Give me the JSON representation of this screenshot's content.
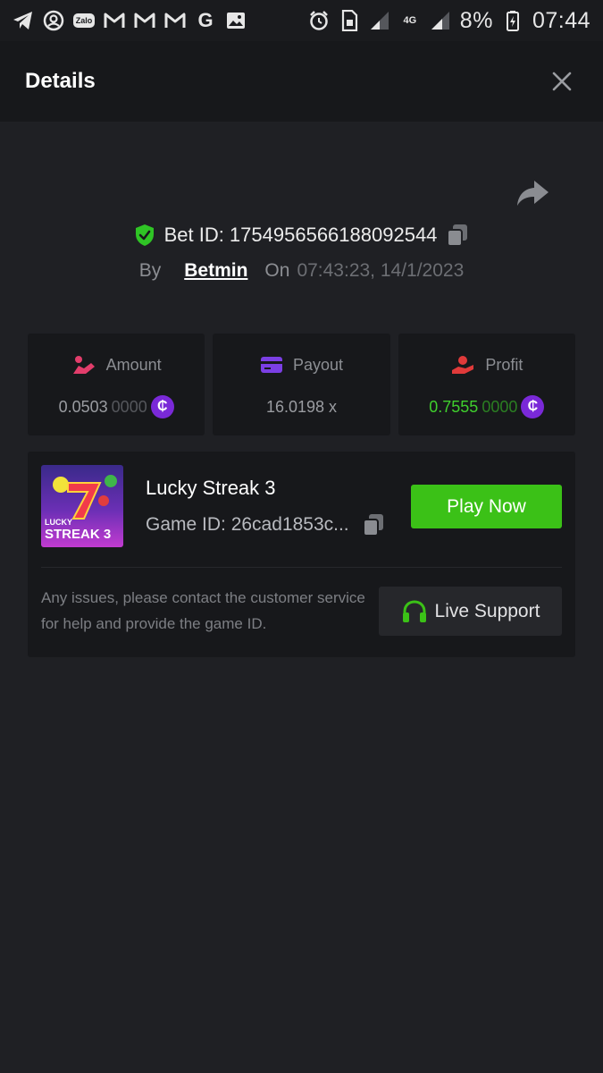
{
  "status_bar": {
    "left_icons": [
      "telegram-icon",
      "account-icon",
      "zalo-icon",
      "gmail-icon",
      "gmail-icon",
      "gmail-icon",
      "google-icon",
      "gallery-icon"
    ],
    "zalo_label": "Zalo",
    "google_letter": "G",
    "network_label": "4G",
    "battery_percent": "8%",
    "time": "07:44"
  },
  "header": {
    "title": "Details"
  },
  "bet": {
    "id_label": "Bet ID: 1754956566188092544",
    "by_label": "By",
    "user": "Betmin",
    "on_label": "On",
    "datetime": "07:43:23, 14/1/2023"
  },
  "stats": {
    "amount": {
      "label": "Amount",
      "value_main": "0.0503",
      "value_dim": "0000",
      "currency_symbol": "₵"
    },
    "payout": {
      "label": "Payout",
      "value": "16.0198 x"
    },
    "profit": {
      "label": "Profit",
      "value_main": "0.7555",
      "value_dim": "0000",
      "currency_symbol": "₵"
    }
  },
  "game": {
    "thumb_line1": "LUCKY",
    "thumb_line2": "STREAK 3",
    "name": "Lucky Streak 3",
    "id_label": "Game ID: 26cad1853c...",
    "play_label": "Play Now",
    "support_text": "Any issues, please contact the customer service for help and provide the game ID.",
    "support_label": "Live Support"
  },
  "colors": {
    "background": "#1f2024",
    "card": "#17181b",
    "accent_green": "#3bc117",
    "profit_green": "#3fcf2d",
    "coin_purple": "#7a29d8",
    "amount_pink": "#e23d6b",
    "payout_purple": "#7b3fe4",
    "profit_red": "#e03a3a"
  }
}
